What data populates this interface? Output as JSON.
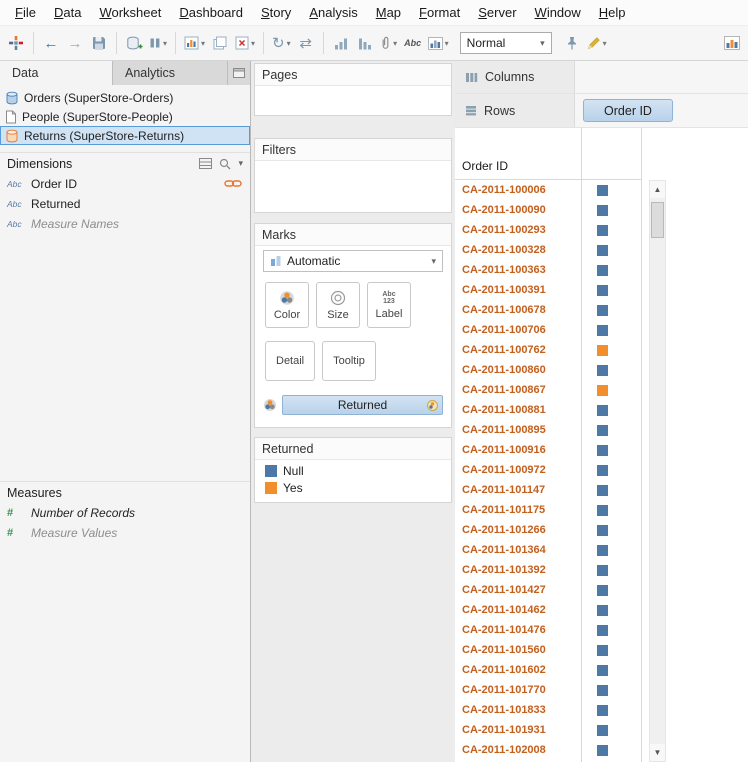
{
  "colors": {
    "null": "#4e79a7",
    "yes": "#f28e2b",
    "row_text": "#c4601d",
    "pill_bg_top": "#d3e3f3",
    "pill_bg_bottom": "#b9d2ea",
    "pill_border": "#8fb3d5"
  },
  "menubar": {
    "items": [
      "File",
      "Data",
      "Worksheet",
      "Dashboard",
      "Story",
      "Analysis",
      "Map",
      "Format",
      "Server",
      "Window",
      "Help"
    ]
  },
  "toolbar": {
    "view_mode": "Normal",
    "groups": [
      {
        "buttons": [
          {
            "icon": "tableau-logo-icon"
          }
        ]
      },
      {
        "buttons": [
          {
            "icon": "back-icon"
          },
          {
            "icon": "forward-icon"
          },
          {
            "icon": "save-icon"
          }
        ]
      },
      {
        "buttons": [
          {
            "icon": "add-data-icon"
          },
          {
            "icon": "pause-updates-icon",
            "dropdown": true
          }
        ]
      },
      {
        "buttons": [
          {
            "icon": "new-worksheet-icon",
            "dropdown": true
          },
          {
            "icon": "duplicate-icon"
          },
          {
            "icon": "clear-sheet-icon",
            "dropdown": true
          }
        ]
      },
      {
        "buttons": [
          {
            "icon": "refresh-icon",
            "dropdown": true
          },
          {
            "icon": "swap-axes-icon"
          }
        ]
      },
      {
        "buttons": [
          {
            "icon": "sort-asc-icon"
          },
          {
            "icon": "sort-desc-icon"
          },
          {
            "icon": "group-icon",
            "dropdown": true
          },
          {
            "icon": "show-labels-icon"
          },
          {
            "icon": "fit-icon",
            "dropdown": true
          }
        ]
      }
    ],
    "right": [
      {
        "icon": "pin-icon"
      },
      {
        "icon": "highlight-icon",
        "dropdown": true
      }
    ],
    "far_right": [
      {
        "icon": "show-me-icon"
      }
    ]
  },
  "data_pane": {
    "tabs": [
      {
        "label": "Data"
      },
      {
        "label": "Analytics"
      }
    ],
    "sources": [
      {
        "label": "Orders (SuperStore-Orders)",
        "icon": "database-icon",
        "selected": false
      },
      {
        "label": "People (SuperStore-People)",
        "icon": "file-icon",
        "selected": false
      },
      {
        "label": "Returns (SuperStore-Returns)",
        "icon": "database-active-icon",
        "selected": true
      }
    ],
    "dimensions": {
      "title": "Dimensions",
      "fields": [
        {
          "label": "Order ID",
          "type": "abc",
          "linked": true,
          "italic": false,
          "muted": false
        },
        {
          "label": "Returned",
          "type": "abc",
          "linked": false,
          "italic": false,
          "muted": false
        },
        {
          "label": "Measure Names",
          "type": "abc",
          "linked": false,
          "italic": true,
          "muted": true
        }
      ]
    },
    "measures": {
      "title": "Measures",
      "fields": [
        {
          "label": "Number of Records",
          "type": "hash",
          "italic": true,
          "muted": false
        },
        {
          "label": "Measure Values",
          "type": "hash",
          "italic": true,
          "muted": true
        }
      ]
    }
  },
  "cards": {
    "pages": {
      "title": "Pages"
    },
    "filters": {
      "title": "Filters"
    },
    "marks": {
      "title": "Marks",
      "mark_type": "Automatic",
      "buttons": [
        {
          "label": "Color",
          "icon": "color-icon"
        },
        {
          "label": "Size",
          "icon": "size-icon"
        },
        {
          "label": "Label",
          "icon": "label-icon"
        },
        {
          "label": "Detail"
        },
        {
          "label": "Tooltip"
        }
      ],
      "pills": [
        {
          "label": "Returned",
          "role": "color"
        }
      ]
    },
    "legend": {
      "title": "Returned",
      "items": [
        {
          "label": "Null",
          "color": "#4e79a7"
        },
        {
          "label": "Yes",
          "color": "#f28e2b"
        }
      ]
    }
  },
  "shelves": {
    "columns": {
      "label": "Columns",
      "pills": []
    },
    "rows": {
      "label": "Rows",
      "pills": [
        {
          "label": "Order ID"
        }
      ]
    }
  },
  "table": {
    "header": "Order ID",
    "rows": [
      {
        "id": "CA-2011-100006",
        "returned": "Null"
      },
      {
        "id": "CA-2011-100090",
        "returned": "Null"
      },
      {
        "id": "CA-2011-100293",
        "returned": "Null"
      },
      {
        "id": "CA-2011-100328",
        "returned": "Null"
      },
      {
        "id": "CA-2011-100363",
        "returned": "Null"
      },
      {
        "id": "CA-2011-100391",
        "returned": "Null"
      },
      {
        "id": "CA-2011-100678",
        "returned": "Null"
      },
      {
        "id": "CA-2011-100706",
        "returned": "Null"
      },
      {
        "id": "CA-2011-100762",
        "returned": "Yes"
      },
      {
        "id": "CA-2011-100860",
        "returned": "Null"
      },
      {
        "id": "CA-2011-100867",
        "returned": "Yes"
      },
      {
        "id": "CA-2011-100881",
        "returned": "Null"
      },
      {
        "id": "CA-2011-100895",
        "returned": "Null"
      },
      {
        "id": "CA-2011-100916",
        "returned": "Null"
      },
      {
        "id": "CA-2011-100972",
        "returned": "Null"
      },
      {
        "id": "CA-2011-101147",
        "returned": "Null"
      },
      {
        "id": "CA-2011-101175",
        "returned": "Null"
      },
      {
        "id": "CA-2011-101266",
        "returned": "Null"
      },
      {
        "id": "CA-2011-101364",
        "returned": "Null"
      },
      {
        "id": "CA-2011-101392",
        "returned": "Null"
      },
      {
        "id": "CA-2011-101427",
        "returned": "Null"
      },
      {
        "id": "CA-2011-101462",
        "returned": "Null"
      },
      {
        "id": "CA-2011-101476",
        "returned": "Null"
      },
      {
        "id": "CA-2011-101560",
        "returned": "Null"
      },
      {
        "id": "CA-2011-101602",
        "returned": "Null"
      },
      {
        "id": "CA-2011-101770",
        "returned": "Null"
      },
      {
        "id": "CA-2011-101833",
        "returned": "Null"
      },
      {
        "id": "CA-2011-101931",
        "returned": "Null"
      },
      {
        "id": "CA-2011-102008",
        "returned": "Null"
      }
    ]
  }
}
